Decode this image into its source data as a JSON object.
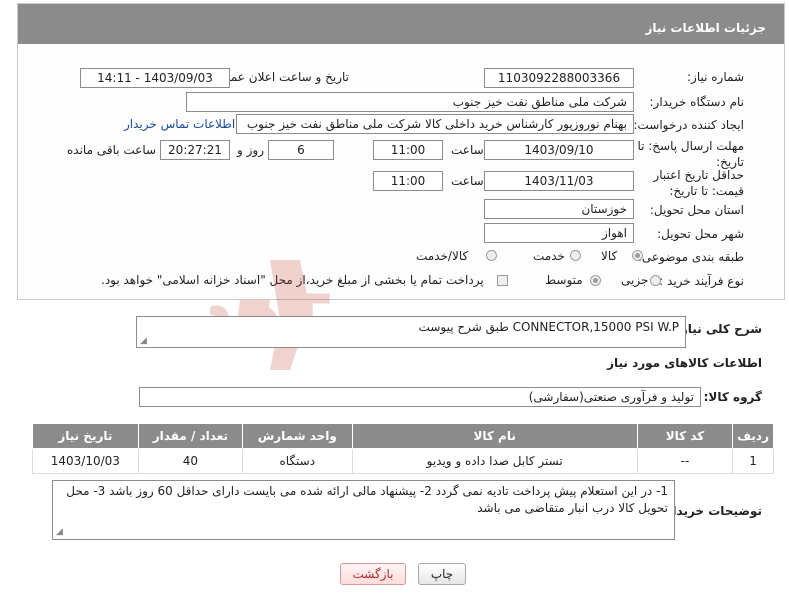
{
  "header": {
    "title": "جزئیات اطلاعات نیاز"
  },
  "fields": {
    "need_number_label": "شماره نیاز:",
    "need_number": "1103092288003366",
    "announce_label": "تاریخ و ساعت اعلان عمومی:",
    "announce_value": "1403/09/03 - 14:11",
    "buyer_label": "نام دستگاه خریدار:",
    "buyer_value": "شرکت ملی مناطق نفت خیز جنوب",
    "creator_label": "ایجاد کننده درخواست:",
    "creator_value": "بهنام  نوروزپور کارشناس خرید داخلی کالا شرکت ملی مناطق نفت خیز جنوب",
    "contact_link": "اطلاعات تماس خریدار",
    "deadline_label": "مهلت ارسال پاسخ: تا تاریخ:",
    "deadline_date": "1403/09/10",
    "time_label": "ساعت",
    "deadline_time": "11:00",
    "days_value": "6",
    "days_and_label": "روز و",
    "remaining_time": "20:27:21",
    "remaining_label": "ساعت باقی مانده",
    "validity_label": "حداقل تاریخ اعتبار قیمت: تا تاریخ:",
    "validity_date": "1403/11/03",
    "validity_time_label": "ساعت",
    "validity_time": "11:00",
    "province_label": "استان محل تحویل:",
    "province_value": "خوزستان",
    "city_label": "شهر محل تحویل:",
    "city_value": "اهواز",
    "category_label": "طبقه بندی موضوعی:",
    "category_options": [
      "کالا",
      "خدمت",
      "کالا/خدمت"
    ],
    "category_selected": "کالا",
    "process_label": "نوع فرآیند خرید :",
    "process_options": [
      "جزیی",
      "متوسط"
    ],
    "process_selected": "متوسط",
    "payment_note": "پرداخت تمام یا بخشی از مبلغ خرید،از محل \"اسناد خزانه اسلامی\" خواهد بود."
  },
  "summary": {
    "label": "شرح کلی نیاز:",
    "value": "CONNECTOR,15000 PSI  W.P     طبق شرح پیوست"
  },
  "goods_section": {
    "title": "اطلاعات کالاهای مورد نیاز",
    "group_label": "گروه کالا:",
    "group_value": "تولید و فرآوری صنعتی(سفارشی)"
  },
  "table": {
    "headers": [
      "ردیف",
      "کد کالا",
      "نام کالا",
      "واحد شمارش",
      "تعداد / مقدار",
      "تاریخ نیاز"
    ],
    "rows": [
      [
        "1",
        "--",
        "تستر کابل صدا داده و ویدیو",
        "دستگاه",
        "40",
        "1403/10/03"
      ]
    ]
  },
  "buyer_notes": {
    "label": "توضیحات خریدار:",
    "value": "1-  در این استعلام پیش پرداخت تادیه نمی گردد  2-  پیشنهاد مالی ارائه شده می بایست دارای حداقل 60 روز باشد  3-  محل تحویل کالا درب انبار متقاضی می باشد"
  },
  "buttons": {
    "print": "چاپ",
    "back": "بازگشت"
  },
  "watermark": {
    "text": "AriaTender.neT",
    "color": "#c0392b"
  }
}
